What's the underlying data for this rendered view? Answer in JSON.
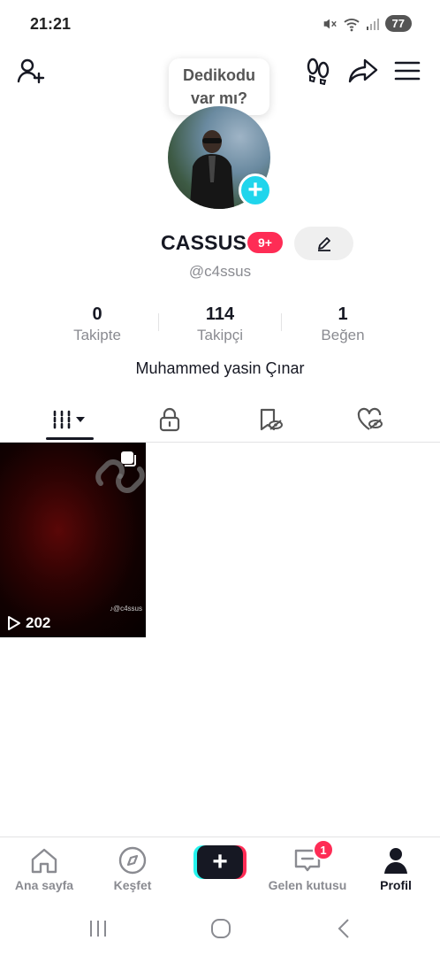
{
  "status_bar": {
    "time": "21:21",
    "battery": "77"
  },
  "header": {
    "bubble_text_line1": "Dedikodu",
    "bubble_text_line2": "var mı?"
  },
  "profile": {
    "username": "CASSUS",
    "notification_badge": "9+",
    "handle": "@c4ssus",
    "bio": "Muhammed yasin Çınar"
  },
  "stats": [
    {
      "value": "0",
      "label": "Takipte"
    },
    {
      "value": "114",
      "label": "Takipçi"
    },
    {
      "value": "1",
      "label": "Beğen"
    }
  ],
  "videos": [
    {
      "views": "202",
      "tag": "♪@c4ssus"
    }
  ],
  "bottom_nav": [
    {
      "label": "Ana sayfa"
    },
    {
      "label": "Keşfet"
    },
    {
      "label": ""
    },
    {
      "label": "Gelen kutusu",
      "badge": "1"
    },
    {
      "label": "Profil"
    }
  ],
  "colors": {
    "accent_pink": "#fe2c55",
    "accent_cyan": "#20d5ec",
    "text_primary": "#161823",
    "text_secondary": "#8a8b91"
  }
}
